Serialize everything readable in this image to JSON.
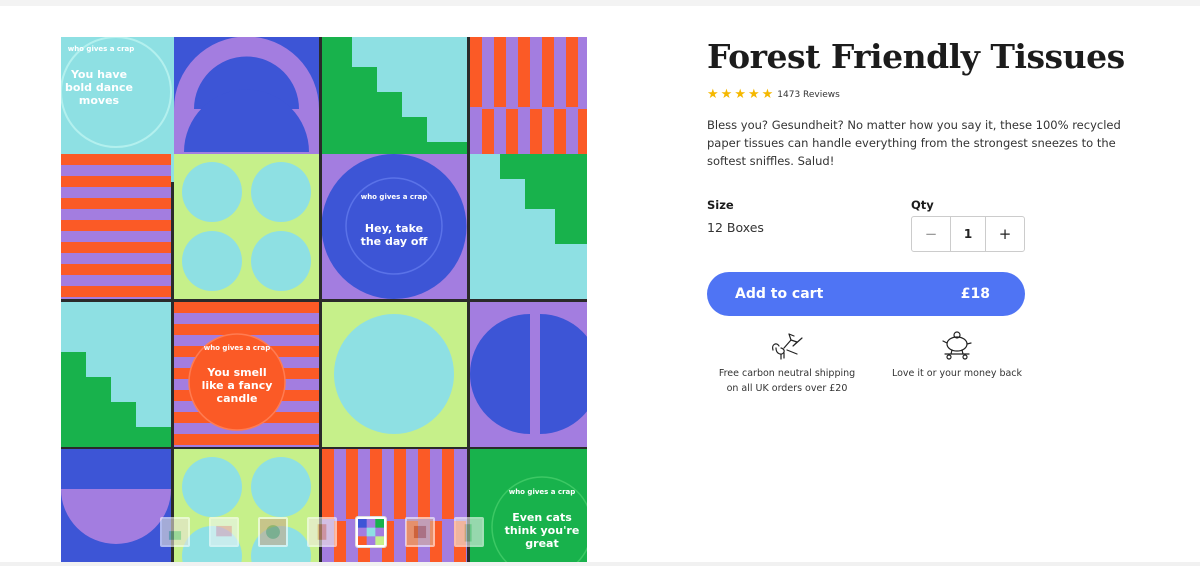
{
  "gallery": {
    "stickers": {
      "brand": "who gives a crap",
      "tile_1": [
        "You have",
        "bold dance",
        "moves"
      ],
      "tile_2": [
        "Hey, take",
        "the day off"
      ],
      "tile_3": [
        "You smell",
        "like a fancy",
        "candle"
      ],
      "tile_4": [
        "Even cats",
        "think you're",
        "great"
      ]
    },
    "thumbnails": 7,
    "active_thumbnail": 5
  },
  "product": {
    "title": "Forest Friendly Tissues",
    "rating_stars": 5,
    "reviews": "1473 Reviews",
    "description": "Bless you? Gesundheit? No matter how you say it, these 100% recycled paper tissues can handle everything from the strongest sneezes to the softest sniffles. Salud!"
  },
  "options": {
    "size_label": "Size",
    "size_value": "12 Boxes",
    "qty_label": "Qty",
    "qty_value": "1",
    "minus": "−",
    "plus": "+"
  },
  "cart": {
    "label": "Add to cart",
    "price": "£18"
  },
  "perks": {
    "shipping_line1": "Free carbon neutral shipping",
    "shipping_line2": "on all UK orders over £20",
    "guarantee": "Love it or your money back"
  },
  "colors": {
    "accent_blue": "#4f74f4",
    "star": "#f5b800",
    "tile_blue": "#3d55d6",
    "tile_purple": "#a37de0",
    "tile_aqua": "#8ee0e3",
    "tile_green": "#18b24c",
    "tile_lime": "#c6f08a",
    "tile_orange": "#fb5a26"
  }
}
